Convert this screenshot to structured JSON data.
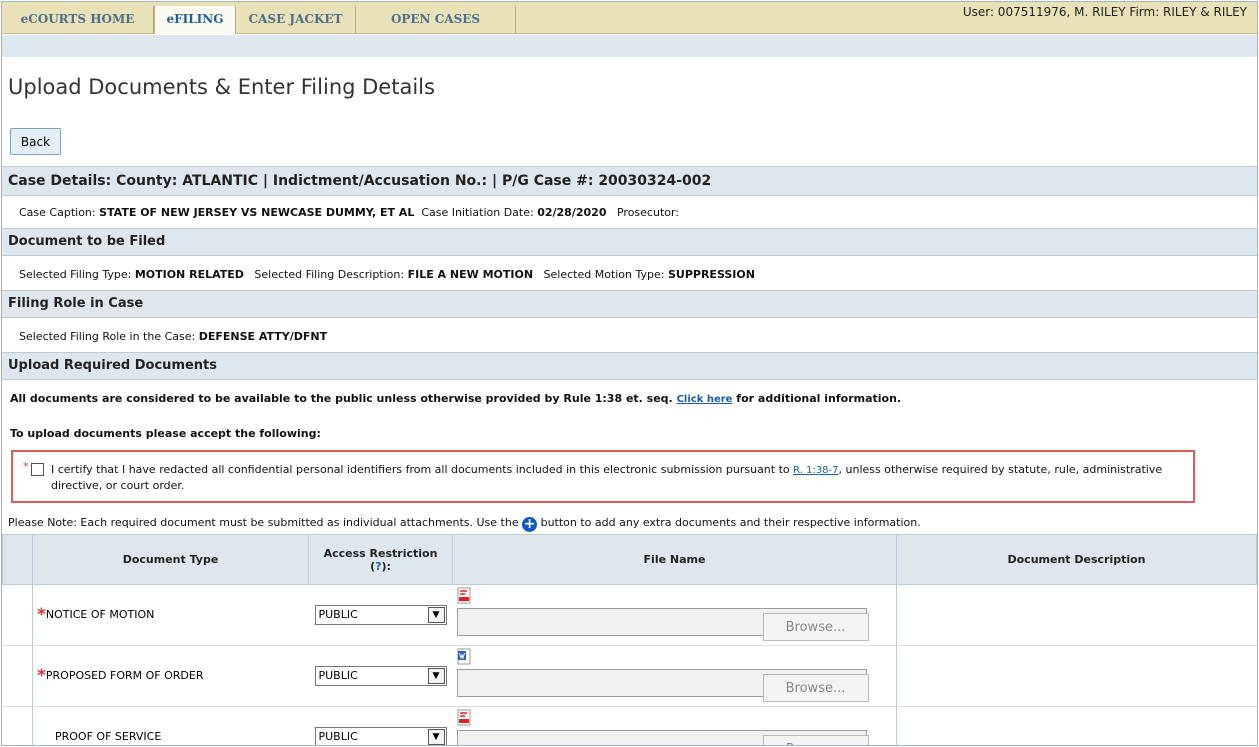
{
  "nav": {
    "tabs": [
      {
        "label": "eCOURTS HOME"
      },
      {
        "label": "eFILING"
      },
      {
        "label": "CASE JACKET"
      },
      {
        "label": "OPEN CASES"
      }
    ],
    "user_info": "User: 007511976, M. RILEY  Firm: RILEY & RILEY"
  },
  "page": {
    "title": "Upload Documents & Enter Filing Details",
    "back_label": "Back"
  },
  "case_details": {
    "header": "Case Details: County: ATLANTIC | Indictment/Accusation No.:  | P/G Case #: 20030324-002",
    "caption_label": "Case Caption:",
    "caption_value": "STATE OF NEW JERSEY VS NEWCASE DUMMY, ET AL",
    "initiation_label": "Case Initiation Date:",
    "initiation_value": "02/28/2020",
    "prosecutor_label": "Prosecutor:"
  },
  "document_to_file": {
    "header": "Document to be Filed",
    "filing_type_label": "Selected Filing Type:",
    "filing_type_value": "MOTION RELATED",
    "filing_desc_label": "Selected Filing Description:",
    "filing_desc_value": "FILE A NEW MOTION",
    "motion_type_label": "Selected Motion Type:",
    "motion_type_value": "SUPPRESSION"
  },
  "filing_role": {
    "header": "Filing Role in Case",
    "role_label": "Selected Filing Role in the Case:",
    "role_value": "DEFENSE ATTY/DFNT"
  },
  "upload": {
    "header": "Upload Required Documents",
    "public_notice_pre": "All documents are considered to be available to the public unless otherwise provided by Rule 1:38 et. seq.",
    "click_here": "Click here",
    "public_notice_post": "for additional information.",
    "accept_prompt": "To upload documents please accept the following:",
    "certify_star": "*",
    "certify_pre": "I certify that I have redacted all confidential personal identifiers from all documents included in this electronic submission pursuant to",
    "certify_link": "R. 1:38-7",
    "certify_post": ", unless otherwise required by statute, rule, administrative directive, or court order.",
    "note_pre": "Please Note: Each required document must be submitted as individual attachments. Use the",
    "note_post": "button to add any extra documents and their respective information."
  },
  "table": {
    "headers": {
      "doc_type": "Document Type",
      "access": "Access Restriction",
      "access_help": "?",
      "file_name": "File Name",
      "description": "Document Description"
    },
    "rows": [
      {
        "required": "*",
        "doc_type": "NOTICE OF MOTION",
        "access": "PUBLIC",
        "file_icon": "pdf-icon",
        "browse": "Browse..."
      },
      {
        "required": "*",
        "doc_type": "PROPOSED FORM OF ORDER",
        "access": "PUBLIC",
        "file_icon": "word-icon",
        "browse": "Browse..."
      },
      {
        "required": "",
        "doc_type": "PROOF OF SERVICE",
        "access": "PUBLIC",
        "file_icon": "pdf-icon",
        "browse": "Browse..."
      }
    ]
  }
}
